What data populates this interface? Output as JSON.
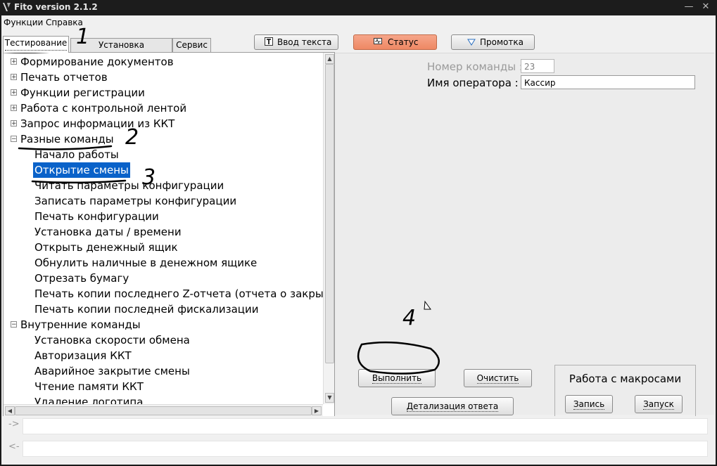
{
  "window": {
    "title": "Fito version 2.1.2",
    "minimize_icon": "minimize-icon",
    "close_icon": "close-icon"
  },
  "menu": [
    "Функции",
    "Справка"
  ],
  "tabs": [
    {
      "label": "Тестирование",
      "active": true
    },
    {
      "label": "Установка параметров",
      "active": false
    },
    {
      "label": "Сервис",
      "active": false
    }
  ],
  "toolbar": {
    "text_input": {
      "label": "Ввод текста",
      "icon": "text-T-icon"
    },
    "status": {
      "label": "Статус",
      "icon": "monitor-icon",
      "active_color": "#f08f6b"
    },
    "scroll": {
      "label": "Промотка",
      "icon": "triangle-down-icon"
    }
  },
  "tree": {
    "items": [
      {
        "label": "Формирование документов",
        "level": 0,
        "expander": "+"
      },
      {
        "label": "Печать отчетов",
        "level": 0,
        "expander": "+"
      },
      {
        "label": "Функции регистрации",
        "level": 0,
        "expander": "+"
      },
      {
        "label": "Работа с контрольной лентой",
        "level": 0,
        "expander": "+"
      },
      {
        "label": "Запрос информации из ККТ",
        "level": 0,
        "expander": "+"
      },
      {
        "label": "Разные команды",
        "level": 0,
        "expander": "−"
      },
      {
        "label": "Начало работы",
        "level": 1
      },
      {
        "label": "Открытие смены",
        "level": 1,
        "selected": true
      },
      {
        "label": "Читать параметры конфигурации",
        "level": 1
      },
      {
        "label": "Записать параметры конфигурации",
        "level": 1
      },
      {
        "label": "Печать конфигурации",
        "level": 1
      },
      {
        "label": "Установка даты / времени",
        "level": 1
      },
      {
        "label": "Открыть денежный ящик",
        "level": 1
      },
      {
        "label": "Обнулить наличные в денежном ящике",
        "level": 1
      },
      {
        "label": "Отрезать бумагу",
        "level": 1
      },
      {
        "label": "Печать копии последнего Z-отчета (отчета о закрытии",
        "level": 1
      },
      {
        "label": "Печать копии последней фискализации",
        "level": 1
      },
      {
        "label": "Внутренние команды",
        "level": 0,
        "expander": "−"
      },
      {
        "label": "Установка скорости обмена",
        "level": 1
      },
      {
        "label": "Авторизация ККТ",
        "level": 1
      },
      {
        "label": "Аварийное закрытие смены",
        "level": 1
      },
      {
        "label": "Чтение памяти ККТ",
        "level": 1
      },
      {
        "label": "Удаление логотипа",
        "level": 1
      }
    ],
    "selection_color": "#0a62c9"
  },
  "params": {
    "command_number": {
      "label": "Номер команды :",
      "value": "23"
    },
    "operator_name": {
      "label": "Имя оператора :",
      "value": "Кассир"
    }
  },
  "actions": {
    "execute": "Выполнить",
    "clear": "Очистить",
    "details": "Детализация ответа"
  },
  "macros": {
    "title": "Работа с макросами",
    "record": "Запись",
    "run": "Запуск"
  },
  "console": {
    "out_prompt": "->",
    "in_prompt": "<-"
  },
  "annotations": [
    "1",
    "2",
    "3",
    "4"
  ]
}
